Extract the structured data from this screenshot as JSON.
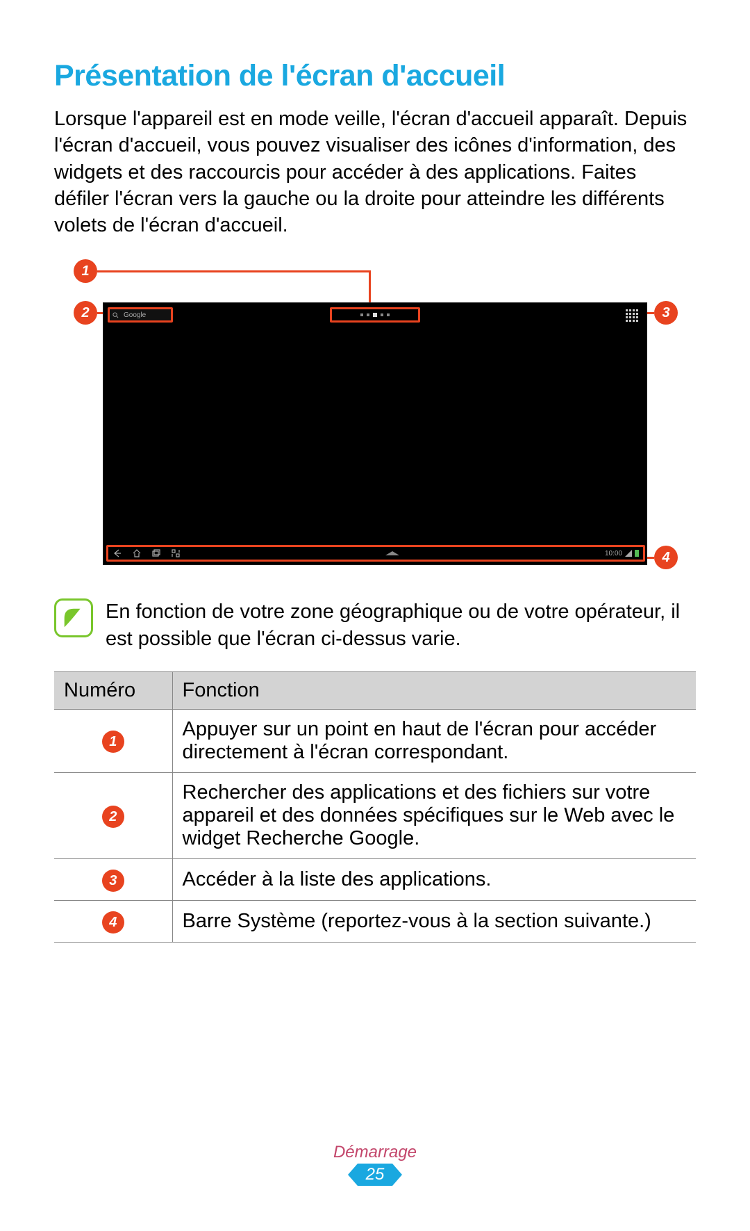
{
  "section_title": "Présentation de l'écran d'accueil",
  "intro_paragraph": "Lorsque l'appareil est en mode veille, l'écran d'accueil apparaît. Depuis l'écran d'accueil, vous pouvez visualiser des icônes d'information, des widgets et des raccourcis pour accéder à des applications. Faites défiler l'écran vers la gauche ou la droite pour atteindre les différents volets de l'écran d'accueil.",
  "diagram": {
    "search_widget_label": "Google",
    "statusbar_time": "10:00",
    "callouts": {
      "c1": "1",
      "c2": "2",
      "c3": "3",
      "c4": "4"
    }
  },
  "note_text": "En fonction de votre zone géographique ou de votre opérateur, il est possible que l'écran ci-dessus varie.",
  "table": {
    "header_number": "Numéro",
    "header_function": "Fonction",
    "rows": [
      {
        "num": "1",
        "desc": "Appuyer sur un point en haut de l'écran pour accéder directement à l'écran correspondant."
      },
      {
        "num": "2",
        "desc": "Rechercher des applications et des fichiers sur votre appareil et des données spécifiques sur le Web avec le widget Recherche Google."
      },
      {
        "num": "3",
        "desc": "Accéder à la liste des applications."
      },
      {
        "num": "4",
        "desc": "Barre Système (reportez-vous à la section suivante.)"
      }
    ]
  },
  "footer": {
    "section_label": "Démarrage",
    "page_number": "25"
  }
}
